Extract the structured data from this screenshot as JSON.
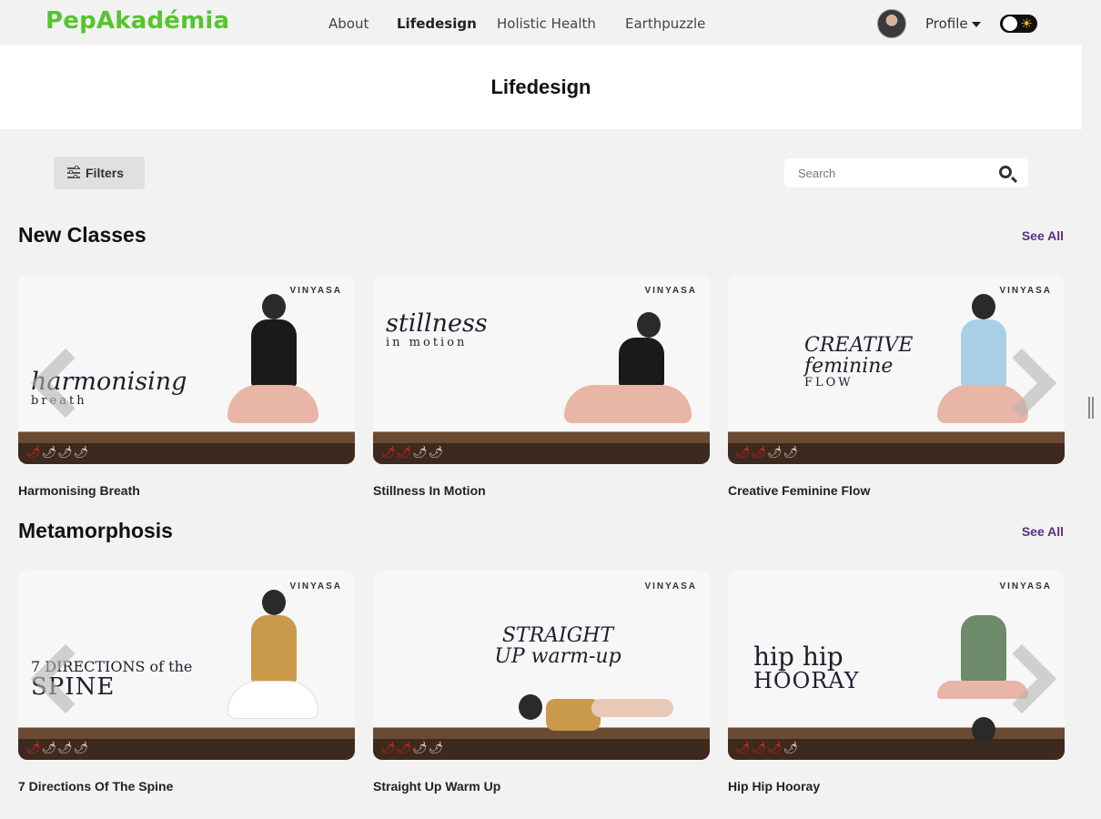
{
  "brand": "PepAkadémia",
  "nav": [
    {
      "label": "About"
    },
    {
      "label": "Lifedesign",
      "active": true
    },
    {
      "label": "Holistic Health"
    },
    {
      "label": "Earthpuzzle"
    }
  ],
  "profile": {
    "label": "Profile"
  },
  "theme_toggle": {
    "state": "light",
    "icon": "sun-icon"
  },
  "page_title": "Lifedesign",
  "filters": {
    "label": "Filters",
    "icon": "sliders-icon"
  },
  "search": {
    "placeholder": "Search",
    "value": ""
  },
  "sections": [
    {
      "title": "New Classes",
      "see_all": "See All",
      "cards": [
        {
          "title": "Harmonising Breath",
          "tag": "VINYASA",
          "art": "harmonising",
          "art_sub": "breath",
          "chili_level": 1,
          "chili_max": 4
        },
        {
          "title": "Stillness In Motion",
          "tag": "VINYASA",
          "art": "stillness",
          "art_sub": "in motion",
          "chili_level": 2,
          "chili_max": 4
        },
        {
          "title": "Creative Feminine Flow",
          "tag": "VINYASA",
          "art": "CREATIVE feminine",
          "art_sub": "FLOW",
          "chili_level": 2,
          "chili_max": 4
        }
      ]
    },
    {
      "title": "Metamorphosis",
      "see_all": "See All",
      "cards": [
        {
          "title": "7 Directions Of The Spine",
          "tag": "VINYASA",
          "art": "7 DIRECTIONS of the",
          "art_sub": "SPINE",
          "chili_level": 1,
          "chili_max": 4
        },
        {
          "title": "Straight Up Warm Up",
          "tag": "VINYASA",
          "art": "STRAIGHT UP warm-up",
          "art_sub": "",
          "chili_level": 2,
          "chili_max": 4
        },
        {
          "title": "Hip Hip Hooray",
          "tag": "VINYASA",
          "art": "hip hip",
          "art_sub": "HOORAY",
          "chili_level": 3,
          "chili_max": 4
        }
      ]
    }
  ],
  "colors": {
    "brand": "#55c52c",
    "link": "#5a2d82",
    "chili": "#dd2222"
  }
}
